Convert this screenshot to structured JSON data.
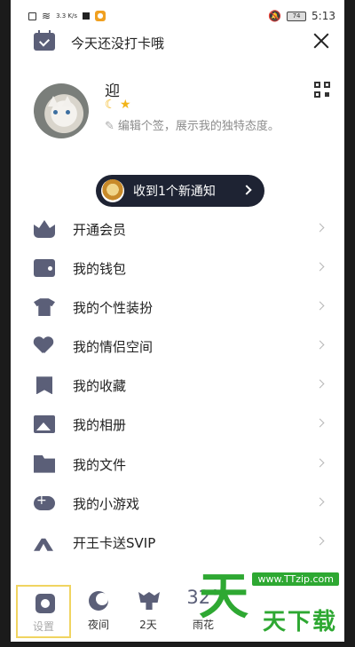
{
  "status_bar": {
    "net_speed": "3.3 K/s",
    "battery": "74",
    "time": "5:13"
  },
  "header": {
    "checkin_text": "今天还没打卡哦"
  },
  "profile": {
    "username": "迎",
    "signature": "编辑个签，展示我的独特态度。"
  },
  "notification": {
    "text": "收到1个新通知"
  },
  "menu": {
    "items": [
      {
        "label": "开通会员",
        "icon": "vip-crown-icon"
      },
      {
        "label": "我的钱包",
        "icon": "wallet-icon"
      },
      {
        "label": "我的个性装扮",
        "icon": "shirt-icon"
      },
      {
        "label": "我的情侣空间",
        "icon": "heart-icon"
      },
      {
        "label": "我的收藏",
        "icon": "bookmark-icon"
      },
      {
        "label": "我的相册",
        "icon": "photo-icon"
      },
      {
        "label": "我的文件",
        "icon": "folder-icon"
      },
      {
        "label": "我的小游戏",
        "icon": "gamepad-icon"
      },
      {
        "label": "开王卡送SVIP",
        "icon": "antenna-icon"
      }
    ]
  },
  "bottom_bar": {
    "settings_label": "设置",
    "night_label": "夜间",
    "days_label": "2天",
    "weather_temp": "32°",
    "weather_label": "雨花"
  },
  "watermark": {
    "url": "www.TTzip.com",
    "text": "天下载",
    "big": "天"
  },
  "colors": {
    "icon": "#5b5f78",
    "pill": "#1e2333",
    "watermark": "#2ea832"
  }
}
